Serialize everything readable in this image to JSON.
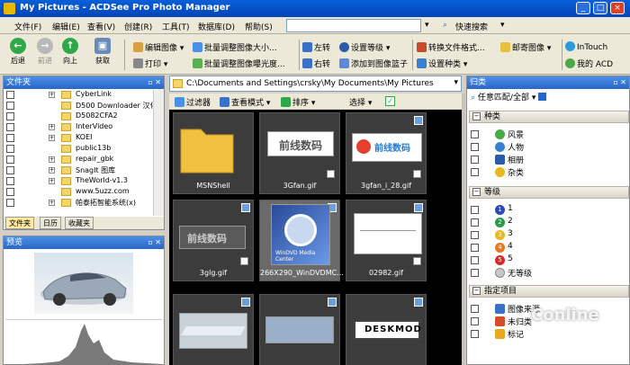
{
  "window": {
    "title": "My Pictures - ACDSee Pro Photo Manager"
  },
  "menu": [
    "文件(F)",
    "编辑(E)",
    "查看(V)",
    "创建(R)",
    "工具(T)",
    "数据库(D)",
    "帮助(S)"
  ],
  "quick_search": "快速搜索",
  "nav": {
    "back": "后退",
    "forward": "前进",
    "up": "向上",
    "acquire": "获取"
  },
  "toolbar": {
    "edit_image": "编辑图像",
    "print": "打印",
    "batch_resize": "批量调整图像大小...",
    "batch_exposure": "批量调整图像曝光度...",
    "rotate_left": "左转",
    "rotate_right": "右转",
    "set_rating": "设置等级",
    "add_to_basket": "添加到图像篮子",
    "convert_format": "转换文件格式...",
    "set_category": "设置种类",
    "email_images": "邮寄图像",
    "intouch": "InTouch",
    "my_acd": "我的 ACD"
  },
  "folder_panel": {
    "title": "文件夹",
    "items": [
      "CyberLink",
      "D500 Downloader 汉化版",
      "D5082CFA2",
      "InterVideo",
      "KOEI",
      "public13b",
      "repair_gbk",
      "SnagIt 图库",
      "TheWorld-v1.3",
      "www.5uzz.com",
      "帕泰拓智能系统(x)"
    ],
    "tabs": [
      "文件夹",
      "日历",
      "收藏夹"
    ]
  },
  "preview_panel": {
    "title": "预览"
  },
  "path": "C:\\Documents and Settings\\crsky\\My Documents\\My Pictures",
  "subbar": {
    "filter": "过滤器",
    "view_mode": "查看模式",
    "sort": "排序",
    "select": "选择"
  },
  "thumbnails": [
    {
      "name": "MSNShell",
      "kind": "folder"
    },
    {
      "name": "3Gfan.gif",
      "kind": "logo",
      "text": "前线数码"
    },
    {
      "name": "3gfan_i_28.gif",
      "kind": "logo2",
      "text": "前线数码"
    },
    {
      "name": "3glg.gif",
      "kind": "dark",
      "text": "前线数码"
    },
    {
      "name": "266X290_WinDVDMC...",
      "kind": "dvd",
      "text": "WinDVD Media Center"
    },
    {
      "name": "02982.gif",
      "kind": "plain"
    },
    {
      "name": "",
      "kind": "plain"
    },
    {
      "name": "",
      "kind": "plain"
    },
    {
      "name": "",
      "kind": "desk",
      "text": "DESKMOD"
    }
  ],
  "category_panel": {
    "title": "归类",
    "match": "任意匹配/全部",
    "sections": {
      "categories": "种类",
      "ratings": "等级",
      "assigned": "指定项目"
    },
    "category_items": [
      "风景",
      "人物",
      "相册",
      "杂类"
    ],
    "rating_items": [
      "1",
      "2",
      "3",
      "4",
      "5",
      "无等级"
    ],
    "assigned_items": [
      "图像来源",
      "未归类",
      "标记"
    ]
  },
  "watermark": "Conline",
  "colors": {
    "title_blue": "#0a5fd8",
    "panel_head": "#2a66c8",
    "grid_bg": "#000000"
  }
}
